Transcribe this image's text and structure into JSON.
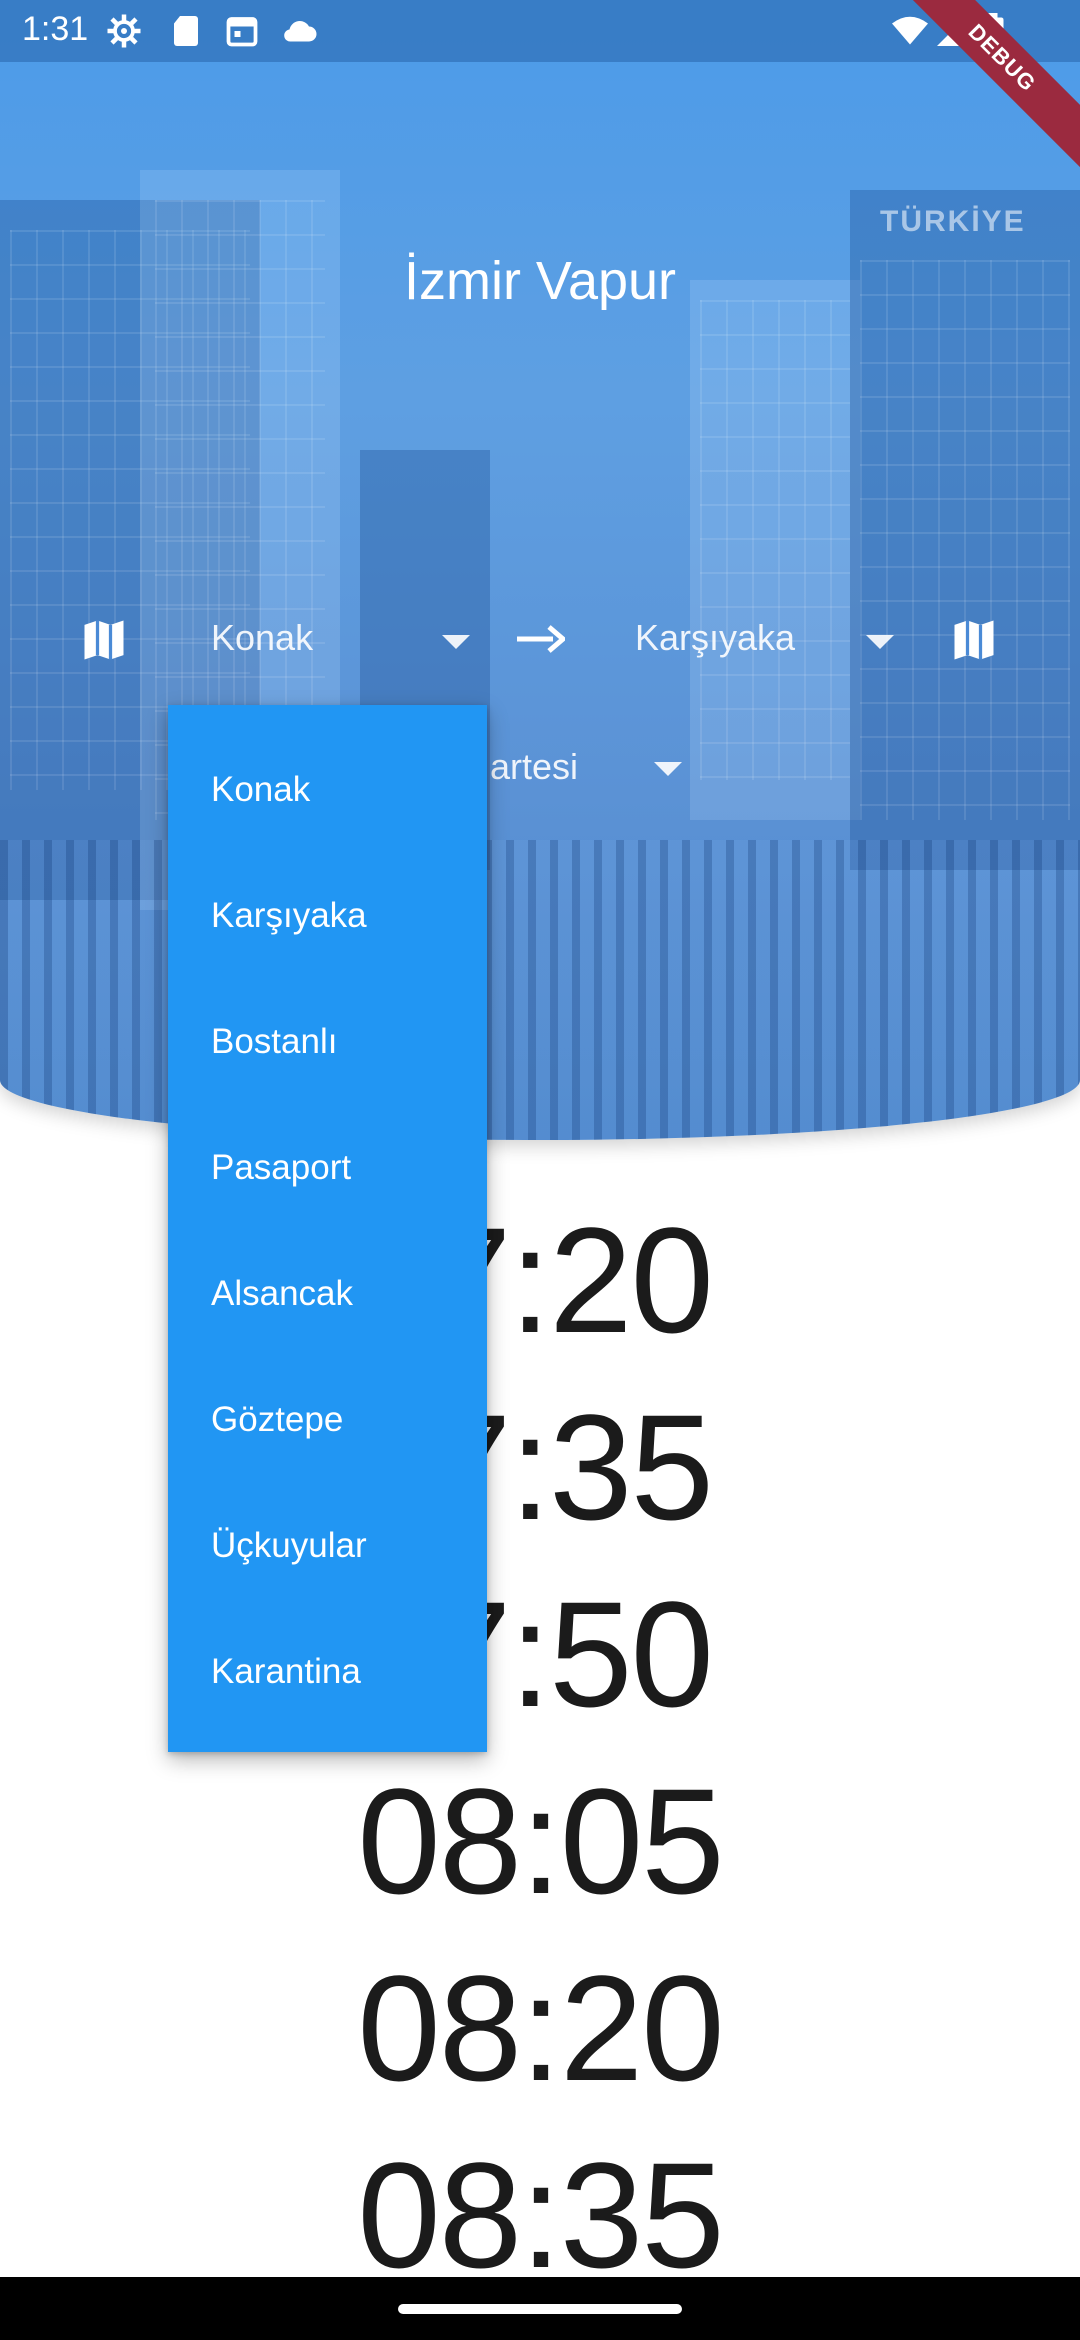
{
  "status_bar": {
    "time": "1:31",
    "left_icons": [
      "gear-icon",
      "sd-card-icon",
      "calendar-icon",
      "cloud-icon"
    ],
    "right_icons": [
      "wifi-icon",
      "signal-icon",
      "battery-icon"
    ]
  },
  "debug_banner": "DEBUG",
  "app": {
    "title": "İzmir Vapur"
  },
  "route": {
    "from": "Konak",
    "to": "Karşıyaka",
    "day_partial": "artesi"
  },
  "dropdown_menu": {
    "options": [
      "Konak",
      "Karşıyaka",
      "Bostanlı",
      "Pasaport",
      "Alsancak",
      "Göztepe",
      "Üçkuyular",
      "Karantina"
    ]
  },
  "departures": {
    "visible_fragments": [
      "7:20",
      "7:35",
      "7:50"
    ],
    "times": [
      "08:05",
      "08:20",
      "08:35"
    ]
  },
  "colors": {
    "accent": "#2196f3",
    "header_overlay": "#4a92de",
    "debug_banner": "#9b2a3f",
    "time_text": "#1b1b1b"
  }
}
